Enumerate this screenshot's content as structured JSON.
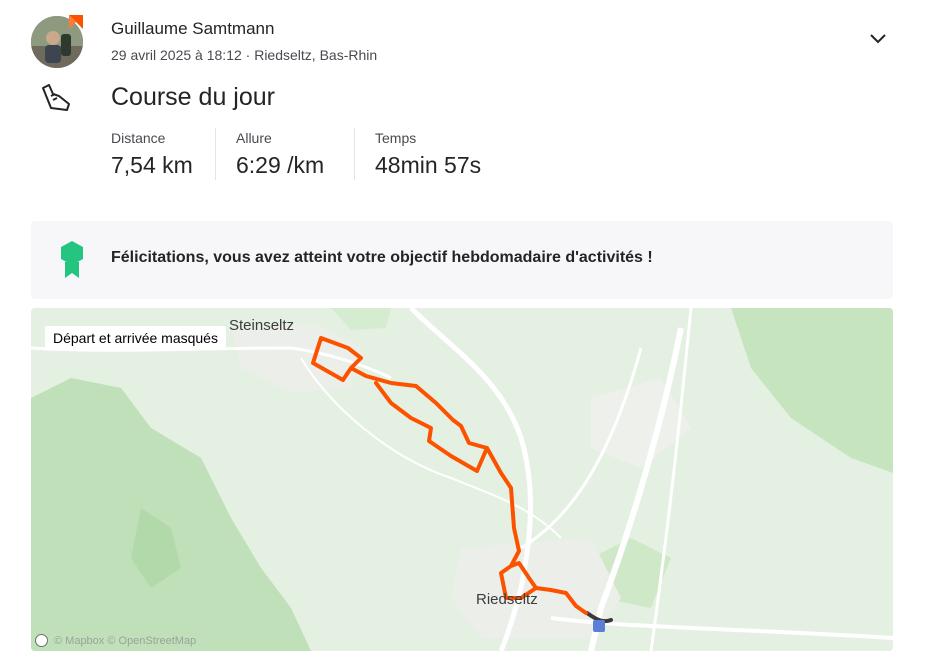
{
  "athlete": {
    "name": "Guillaume Samtmann",
    "meta": "29 avril 2025 à 18:12 · Riedseltz, Bas-Rhin"
  },
  "activity": {
    "title": "Course du jour",
    "sport_icon": "running-shoe-icon",
    "stats": [
      {
        "label": "Distance",
        "value": "7,54 km"
      },
      {
        "label": "Allure",
        "value": "6:29 /km"
      },
      {
        "label": "Temps",
        "value": "48min 57s"
      }
    ]
  },
  "banner": {
    "icon": "achievement-badge-icon",
    "text": "Félicitations, vous avez atteint votre objectif hebdomadaire d'activités !"
  },
  "map": {
    "privacy_tag": "Départ et arrivée masqués",
    "places": [
      "Steinseltz",
      "Riedseltz"
    ],
    "attribution": "© Mapbox © OpenStreetMap",
    "route_color": "#fc5200",
    "hidden_segment_color": "#3a3a3a"
  },
  "colors": {
    "accent": "#fc5200",
    "badge_green": "#25c481"
  }
}
